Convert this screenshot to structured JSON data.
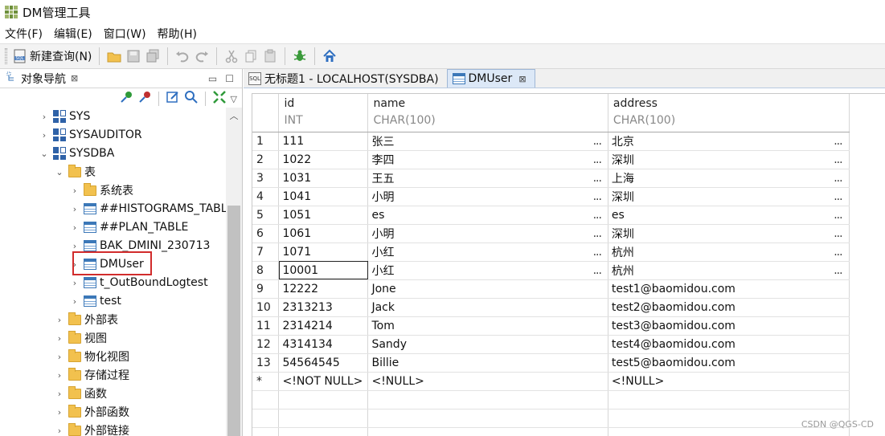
{
  "window": {
    "title": "DM管理工具"
  },
  "menu": [
    "文件(F)",
    "编辑(E)",
    "窗口(W)",
    "帮助(H)"
  ],
  "toolbar": {
    "new_query_label": "新建查询(N)",
    "icons": [
      "open-folder-icon",
      "save-icon",
      "save-all-icon",
      "undo-icon",
      "redo-icon",
      "cut-icon",
      "copy-icon",
      "paste-icon",
      "debug-bug-icon",
      "home-icon"
    ]
  },
  "navigator": {
    "title": "对象导航",
    "close": "⊠",
    "tree": [
      {
        "label": "SYS",
        "type": "schema",
        "expanded": false,
        "level": 0
      },
      {
        "label": "SYSAUDITOR",
        "type": "schema",
        "expanded": false,
        "level": 0
      },
      {
        "label": "SYSDBA",
        "type": "schema",
        "expanded": true,
        "level": 0
      },
      {
        "label": "表",
        "type": "folder",
        "expanded": true,
        "level": 1
      },
      {
        "label": "系统表",
        "type": "folder",
        "expanded": false,
        "level": 2
      },
      {
        "label": "##HISTOGRAMS_TABLE",
        "type": "table",
        "expanded": false,
        "level": 2
      },
      {
        "label": "##PLAN_TABLE",
        "type": "table",
        "expanded": false,
        "level": 2
      },
      {
        "label": "BAK_DMINI_230713",
        "type": "table",
        "expanded": false,
        "level": 2
      },
      {
        "label": "DMUser",
        "type": "table",
        "expanded": false,
        "level": 2,
        "highlighted": true
      },
      {
        "label": "t_OutBoundLogtest",
        "type": "table",
        "expanded": false,
        "level": 2
      },
      {
        "label": "test",
        "type": "table",
        "expanded": false,
        "level": 2
      },
      {
        "label": "外部表",
        "type": "folder",
        "expanded": false,
        "level": 1
      },
      {
        "label": "视图",
        "type": "folder",
        "expanded": false,
        "level": 1
      },
      {
        "label": "物化视图",
        "type": "folder",
        "expanded": false,
        "level": 1
      },
      {
        "label": "存储过程",
        "type": "folder",
        "expanded": false,
        "level": 1
      },
      {
        "label": "函数",
        "type": "folder",
        "expanded": false,
        "level": 1
      },
      {
        "label": "外部函数",
        "type": "folder",
        "expanded": false,
        "level": 1
      },
      {
        "label": "外部链接",
        "type": "folder",
        "expanded": false,
        "level": 1
      }
    ]
  },
  "editor": {
    "tabs": [
      {
        "label": "无标题1 - LOCALHOST(SYSDBA)",
        "active": false,
        "close": ""
      },
      {
        "label": "DMUser",
        "active": true,
        "close": "⊠"
      }
    ],
    "columns": [
      {
        "name": "id",
        "type": "INT"
      },
      {
        "name": "name",
        "type": "CHAR(100)"
      },
      {
        "name": "address",
        "type": "CHAR(100)"
      }
    ],
    "rows": [
      {
        "n": "1",
        "id": "111",
        "name": "张三",
        "address": "北京"
      },
      {
        "n": "2",
        "id": "1022",
        "name": "李四",
        "address": "深圳"
      },
      {
        "n": "3",
        "id": "1031",
        "name": "王五",
        "address": "上海"
      },
      {
        "n": "4",
        "id": "1041",
        "name": "小明",
        "address": "深圳"
      },
      {
        "n": "5",
        "id": "1051",
        "name": "es",
        "address": "es"
      },
      {
        "n": "6",
        "id": "1061",
        "name": "小明",
        "address": "深圳"
      },
      {
        "n": "7",
        "id": "1071",
        "name": "小红",
        "address": "杭州"
      },
      {
        "n": "8",
        "id": "10001",
        "name": "小红",
        "address": "杭州"
      },
      {
        "n": "9",
        "id": "12222",
        "name": "Jone",
        "address": "test1@baomidou.com"
      },
      {
        "n": "10",
        "id": "2313213",
        "name": "Jack",
        "address": "test2@baomidou.com"
      },
      {
        "n": "11",
        "id": "2314214",
        "name": "Tom",
        "address": "test3@baomidou.com"
      },
      {
        "n": "12",
        "id": "4314134",
        "name": "Sandy",
        "address": "test4@baomidou.com"
      },
      {
        "n": "13",
        "id": "54564545",
        "name": "Billie",
        "address": "test5@baomidou.com"
      },
      {
        "n": "*",
        "id": "<!NOT NULL>",
        "name": "<!NULL>",
        "address": "<!NULL>"
      }
    ],
    "selected_cell": {
      "row": "8",
      "col": "id"
    },
    "ellipsis": "..."
  },
  "watermark": "CSDN @QGS-CD"
}
